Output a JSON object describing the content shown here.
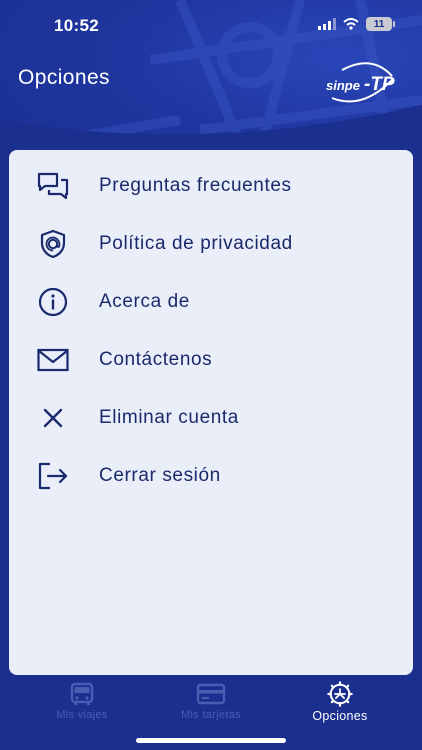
{
  "status_bar": {
    "time": "10:52",
    "battery_level": "11"
  },
  "header": {
    "title": "Opciones",
    "brand_logo_text": "sinpe-TP"
  },
  "menu": {
    "items": [
      {
        "label": "Preguntas frecuentes",
        "icon": "chat-bubbles-icon"
      },
      {
        "label": "Política de privacidad",
        "icon": "shield-icon"
      },
      {
        "label": "Acerca de",
        "icon": "info-icon"
      },
      {
        "label": "Contáctenos",
        "icon": "mail-icon"
      },
      {
        "label": "Eliminar cuenta",
        "icon": "close-icon"
      },
      {
        "label": "Cerrar sesión",
        "icon": "logout-icon"
      }
    ]
  },
  "bottom_nav": {
    "items": [
      {
        "label": "Mis viajes",
        "icon": "bus-icon",
        "active": false
      },
      {
        "label": "Mis tarjetas",
        "icon": "card-icon",
        "active": false
      },
      {
        "label": "Opciones",
        "icon": "options-gear-icon",
        "active": true
      }
    ]
  },
  "colors": {
    "primary": "#1b2f8e",
    "card_bg": "#e9eef9",
    "text": "#1a2a6c",
    "inactive_nav": "#4b5db2"
  }
}
